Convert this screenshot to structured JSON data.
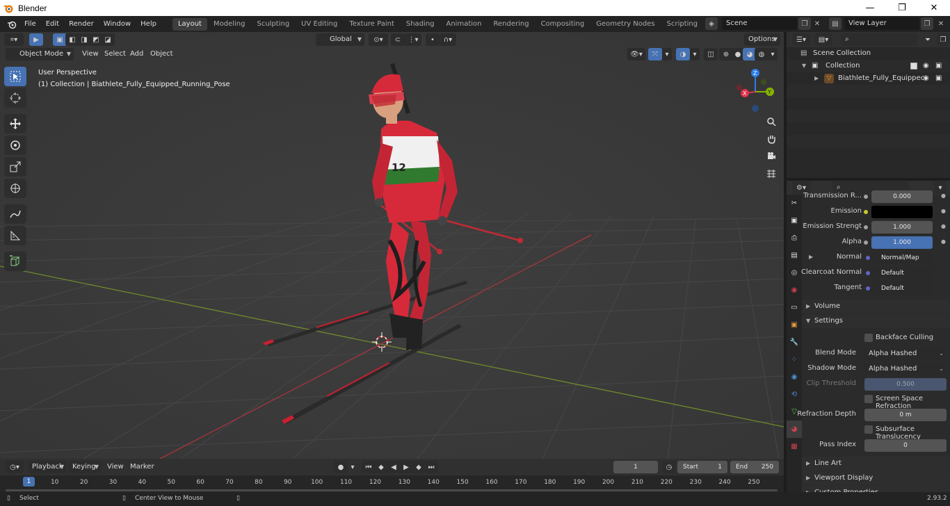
{
  "window": {
    "title": "Blender",
    "minimize": "—",
    "maximize": "❐",
    "close": "✕"
  },
  "menubar": {
    "items": [
      "File",
      "Edit",
      "Render",
      "Window",
      "Help"
    ],
    "workspaces": [
      "Layout",
      "Modeling",
      "Sculpting",
      "UV Editing",
      "Texture Paint",
      "Shading",
      "Animation",
      "Rendering",
      "Compositing",
      "Geometry Nodes",
      "Scripting"
    ],
    "active_workspace": "Layout",
    "scene": "Scene",
    "view_layer": "View Layer"
  },
  "viewport": {
    "mode": "Object Mode",
    "menus": [
      "View",
      "Select",
      "Add",
      "Object"
    ],
    "transform_orientation": "Global",
    "options_label": "Options",
    "perspective_label": "User Perspective",
    "collection_label": "(1) Collection | Biathlete_Fully_Equipped_Running_Pose",
    "bib_number": "12",
    "gizmo": {
      "x": "X",
      "y": "Y",
      "z": "Z"
    }
  },
  "outliner": {
    "rows": [
      {
        "label": "Scene Collection"
      },
      {
        "label": "Collection"
      },
      {
        "label": "Biathlete_Fully_Equippec"
      }
    ]
  },
  "properties": {
    "rows": [
      {
        "label": "Transmission R...",
        "value": "0.000",
        "kind": "num"
      },
      {
        "label": "Emission",
        "value": "",
        "kind": "black"
      },
      {
        "label": "Emission Strengt",
        "value": "1.000",
        "kind": "num"
      },
      {
        "label": "Alpha",
        "value": "1.000",
        "kind": "blue"
      },
      {
        "label": "Normal",
        "value": "Normal/Map",
        "kind": "link"
      },
      {
        "label": "Clearcoat Normal",
        "value": "Default",
        "kind": "link"
      },
      {
        "label": "Tangent",
        "value": "Default",
        "kind": "link"
      }
    ],
    "volume_label": "Volume",
    "settings_label": "Settings",
    "backface_culling": "Backface Culling",
    "blend_mode_label": "Blend Mode",
    "blend_mode": "Alpha Hashed",
    "shadow_mode_label": "Shadow Mode",
    "shadow_mode": "Alpha Hashed",
    "clip_threshold_label": "Clip Threshold",
    "clip_threshold": "0.500",
    "ssr_label": "Screen Space Refraction",
    "refraction_depth_label": "Refraction Depth",
    "refraction_depth": "0 m",
    "subsurface_label": "Subsurface Translucency",
    "pass_index_label": "Pass Index",
    "pass_index": "0",
    "line_art_label": "Line Art",
    "viewport_display_label": "Viewport Display",
    "custom_properties_label": "Custom Properties"
  },
  "timeline": {
    "menus": [
      "Playback",
      "Keying",
      "View",
      "Marker"
    ],
    "current_frame": "1",
    "start_label": "Start",
    "start": "1",
    "end_label": "End",
    "end": "250",
    "ticks": [
      "1",
      "10",
      "20",
      "30",
      "40",
      "50",
      "60",
      "70",
      "80",
      "90",
      "100",
      "110",
      "120",
      "130",
      "140",
      "150",
      "160",
      "170",
      "180",
      "190",
      "200",
      "210",
      "220",
      "230",
      "240",
      "250"
    ]
  },
  "statusbar": {
    "select": "Select",
    "center_view": "Center View to Mouse",
    "version": "2.93.2"
  },
  "colors": {
    "accent": "#4772b3",
    "x_axis": "#e0314b",
    "y_axis": "#86b300",
    "z_axis": "#2b7de9",
    "suit_red": "#d62a3a"
  }
}
